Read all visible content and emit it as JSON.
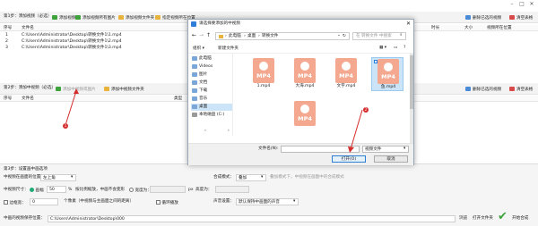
{
  "app": {
    "window_controls": [
      "–",
      "□",
      "✕"
    ],
    "step1": {
      "label": "第1步：添加视频（必选）",
      "add_video_button": "添加视频",
      "add_video_from_folder_button": "添加视频所有图片",
      "add_folder_button": "添加视频文件夹",
      "set_path_button": "指定视频所在位置",
      "delete_selected_button": "删除已选的视频",
      "clear_list_button": "清空表格"
    },
    "table1": {
      "columns": [
        "序号",
        "文件名",
        "类型",
        "时长",
        "大小",
        "视频所在位置"
      ],
      "rows": [
        {
          "index": "1",
          "file": "C:\\Users\\Administrator\\Desktop\\转换文件1\\1.mp4",
          "type": "视频"
        },
        {
          "index": "2",
          "file": "C:\\Users\\Administrator\\Desktop\\转换文件1\\2.mp4",
          "type": "视频"
        },
        {
          "index": "3",
          "file": "C:\\Users\\Administrator\\Desktop\\转换文件1\\3.mp4",
          "type": "视频"
        }
      ]
    },
    "step2": {
      "label": "第2步：添加中视频（必选）",
      "add_mid_video_button": "添加中视频或图片",
      "add_folder_button": "添加中视频文件夹",
      "delete_selected_button": "删除已选的视频",
      "clear_list_button": "清空表格"
    },
    "table2": {
      "columns": [
        "序号",
        "文件名",
        "类型"
      ],
      "badge_number": "1"
    },
    "step3": {
      "label": "第3步：设置画中画选项",
      "position_label": "中视频在画面的位置：",
      "position_value": "左上角",
      "mode_label": "合成模式：",
      "mode_value": "叠加",
      "mode_hint": "叠加模式下，中视频在画面中的合成模式",
      "size_label": "中视频尺寸：",
      "ratio_label": "画幅",
      "ratio_value": "50",
      "ratio_unit": "%",
      "ratio_hint": "按比例缩放，中画不会变形",
      "width_label": "宽度为：",
      "width_unit": "px",
      "height_label": "高度为：",
      "opacity_label": "透明度：",
      "opacity_value": "0",
      "border_label": "边框宽：",
      "border_value": "0",
      "border_hint": "个像素（中视频与主画面之间的距离）",
      "loop_label": "循环播放",
      "sound_label": "声音设置：",
      "sound_value": "默认保持中画面的声音"
    },
    "output": {
      "label": "中画的视频保存位置：",
      "path": "C:\\Users\\Administrator\\Desktop\\000",
      "browse_button": "浏览",
      "open_folder_button": "打开文件夹",
      "start_button": "开始合成"
    }
  },
  "dialog": {
    "title": "请选择要添加的中视频",
    "breadcrumb": [
      "此电脑",
      "桌面",
      "转换文件"
    ],
    "search_placeholder": "在 转换文件 中搜索",
    "organize_button": "组织 ▾",
    "new_folder_button": "新建文件夹",
    "nav_items": [
      {
        "label": "此电脑",
        "selected": false
      },
      {
        "label": "Videos",
        "selected": false
      },
      {
        "label": "图片",
        "selected": false
      },
      {
        "label": "文档",
        "selected": false
      },
      {
        "label": "下载",
        "selected": false
      },
      {
        "label": "音乐",
        "selected": false
      },
      {
        "label": "桌面",
        "selected": true
      },
      {
        "label": "本地磁盘 (C:)",
        "selected": false
      }
    ],
    "files": [
      {
        "name": "1.mp4",
        "thumb": "MP4",
        "selected": false
      },
      {
        "name": "大海.mp4",
        "thumb": "MP4",
        "selected": false
      },
      {
        "name": "文字.mp4",
        "thumb": "MP4",
        "selected": false
      },
      {
        "name": "鱼.mp4",
        "thumb": "MP4",
        "selected": true
      },
      {
        "name": "",
        "thumb": "MP4",
        "selected": false
      }
    ],
    "filename_label": "文件名(N):",
    "filetype_value": "视频文件",
    "open_button": "打开(O)",
    "cancel_button": "取消",
    "badge_number": "2"
  },
  "colors": {
    "accent_green": "#3da33a",
    "thumb_orange": "#f3a88f",
    "badge_red": "#d42d2d",
    "selection_blue": "#cce4f7"
  }
}
